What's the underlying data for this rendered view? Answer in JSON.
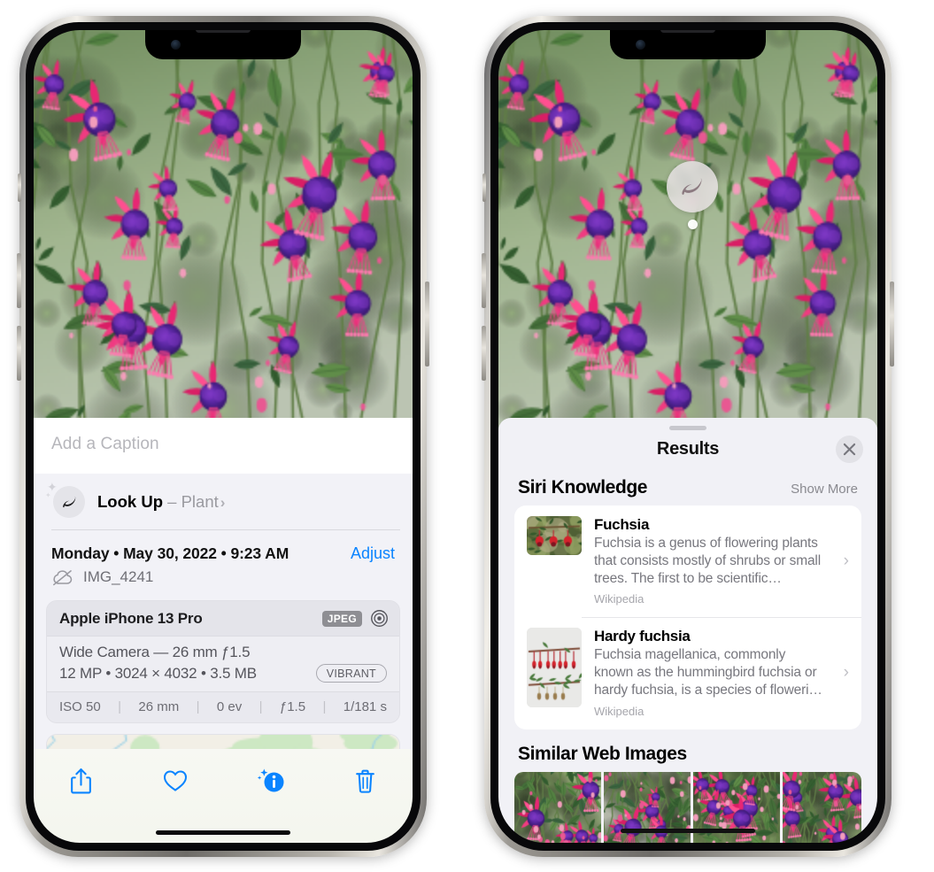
{
  "left_phone": {
    "name": "photos-info-screen",
    "caption": {
      "placeholder": "Add a Caption",
      "value": ""
    },
    "lookup": {
      "title": "Look Up",
      "dash": " – ",
      "subject": "Plant",
      "chevron": "›"
    },
    "date_row": {
      "date": "Monday • May 30, 2022 • 9:23 AM",
      "adjust": "Adjust"
    },
    "file_row": {
      "filename": "IMG_4241"
    },
    "metadata": {
      "device": "Apple iPhone 13 Pro",
      "format_chip": "JPEG",
      "lens_line": "Wide Camera — 26 mm ƒ1.5",
      "size_line": "12 MP • 3024 × 4032 • 3.5 MB",
      "style_chip": "VIBRANT",
      "exif": [
        "ISO 50",
        "26 mm",
        "0 ev",
        "ƒ1.5",
        "1/181 s"
      ]
    },
    "toolbar": {
      "share": "share-icon",
      "favorite": "heart-icon",
      "info": "info-sparkle-icon",
      "delete": "trash-icon"
    }
  },
  "right_phone": {
    "name": "visual-lookup-results-screen",
    "badge": {
      "icon": "leaf-icon"
    },
    "sheet": {
      "title": "Results",
      "close": "✕",
      "siri_knowledge": {
        "title": "Siri Knowledge",
        "show_more": "Show More",
        "cards": [
          {
            "title": "Fuchsia",
            "description": "Fuchsia is a genus of flowering plants that consists mostly of shrubs or small trees. The first to be scientific…",
            "source": "Wikipedia",
            "chevron": "›"
          },
          {
            "title": "Hardy fuchsia",
            "description": "Fuchsia magellanica, commonly known as the hummingbird fuchsia or hardy fuchsia, is a species of floweri…",
            "source": "Wikipedia",
            "chevron": "›"
          }
        ]
      },
      "similar_web_images": {
        "title": "Similar Web Images",
        "count": 4
      }
    }
  },
  "colors": {
    "accent_blue": "#0a84ff",
    "sheet_bg": "#f1f1f6",
    "card_bg": "#ffffff",
    "meta_card_bg": "#ebebf0",
    "secondary_text": "#77777e",
    "chip_gray": "#8e8e93"
  }
}
